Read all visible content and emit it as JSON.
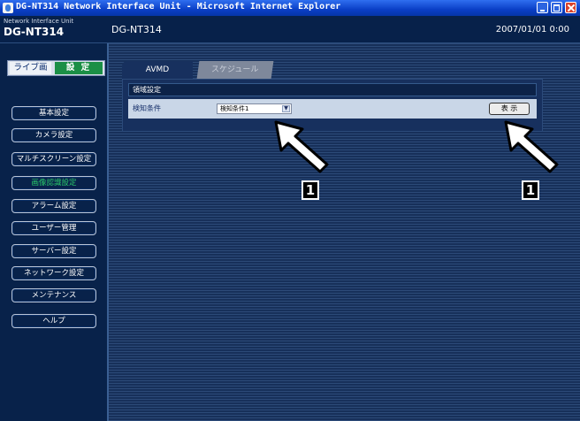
{
  "window": {
    "title": "DG-NT314 Network Interface Unit - Microsoft Internet Explorer"
  },
  "header": {
    "product_small": "Network Interface Unit",
    "product_big": "DG-NT314",
    "device_name": "DG-NT314",
    "datetime": "2007/01/01  0:00"
  },
  "mode": {
    "live": "ライブ画",
    "setup": "設 定"
  },
  "menu": [
    {
      "label": "基本設定"
    },
    {
      "label": "カメラ設定"
    },
    {
      "label": "マルチスクリーン設定"
    },
    {
      "label": "画像認識設定",
      "active": true
    },
    {
      "label": "アラーム設定"
    },
    {
      "label": "ユーザー管理"
    },
    {
      "label": "サーバー設定"
    },
    {
      "label": "ネットワーク設定"
    },
    {
      "label": "メンテナンス"
    },
    {
      "label": "ヘルプ"
    }
  ],
  "tabs": [
    {
      "label": "AVMD",
      "active": true
    },
    {
      "label": "スケジュール",
      "active": false
    }
  ],
  "panel": {
    "section_title": "領域設定",
    "condition_label": "検知条件",
    "condition_value": "検知条件1",
    "show_button": "表 示"
  },
  "callouts": [
    "1",
    "1"
  ],
  "colors": {
    "active_menu": "#2ac86a",
    "setup_mode": "#1b8f46",
    "header_bg": "#07214a"
  }
}
